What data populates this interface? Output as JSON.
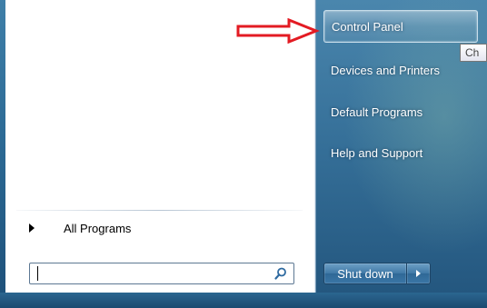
{
  "start_menu": {
    "all_programs_label": "All Programs",
    "search": {
      "value": "",
      "placeholder": ""
    },
    "right_items": [
      {
        "label": "Control Panel",
        "selected": true
      },
      {
        "label": "Devices and Printers",
        "selected": false
      },
      {
        "label": "Default Programs",
        "selected": false
      },
      {
        "label": "Help and Support",
        "selected": false
      }
    ],
    "tooltip": "Ch",
    "shutdown_label": "Shut down"
  },
  "annotation": {
    "arrow_color": "#e31b23"
  },
  "colors": {
    "menu_blue": "#356f98",
    "selection_border": "#dcebf5"
  }
}
